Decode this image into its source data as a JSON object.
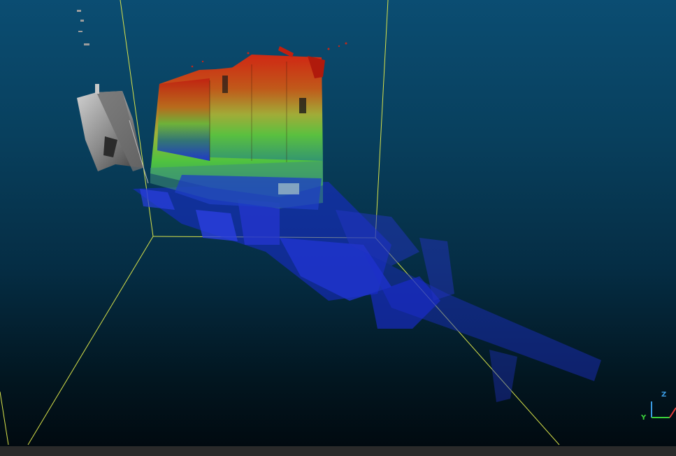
{
  "viewer": {
    "background_top": "#0b4d72",
    "background_bottom": "#010a10",
    "bounding_box_color": "#d8e24a",
    "point_cloud_colormap": [
      "#1a2bd6",
      "#2a8a5a",
      "#4ec23c",
      "#cdb12a",
      "#c12a14"
    ],
    "camera_model_color": "#9a9a9a"
  },
  "axis_gizmo": {
    "x_label": "",
    "y_label": "Y",
    "z_label": "Z",
    "x_color": "#e23b3b",
    "y_color": "#3bd23b",
    "z_color": "#3b9be2"
  },
  "status_bar": {
    "color": "#2a2a2a"
  }
}
